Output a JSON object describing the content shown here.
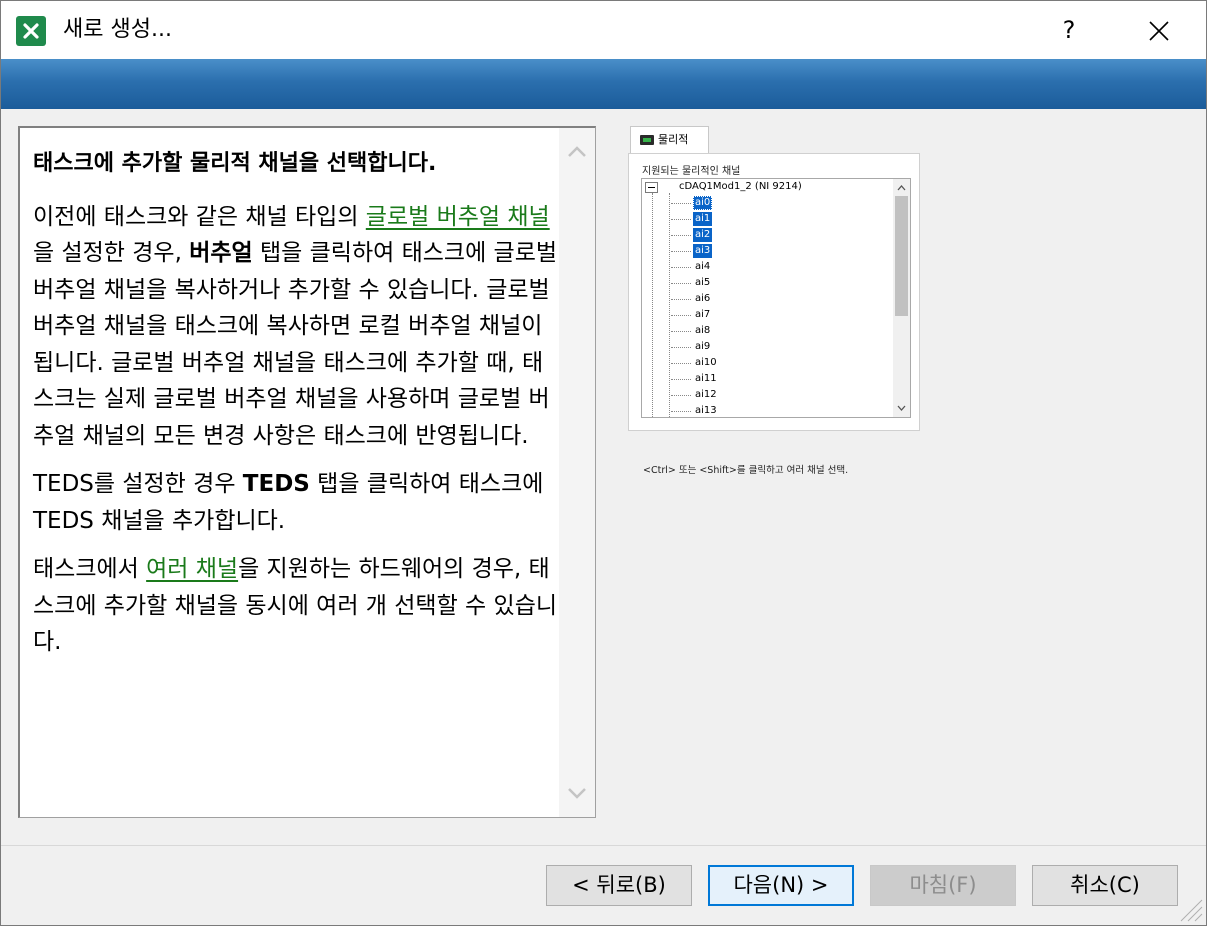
{
  "window": {
    "title": "새로 생성...",
    "help_label": "?"
  },
  "help": {
    "heading": "태스크에 추가할 물리적 채널을 선택합니다.",
    "p1": {
      "t1": "이전에 태스크와 같은 채널 타입의 ",
      "link1": "글로벌 버추얼 채널",
      "t2": "을 설정한 경우, ",
      "bold1": "버추얼",
      "t3": " 탭을 클릭하여 태스크에 글로벌 버추얼 채널을 복사하거나 추가할 수 있습니다. 글로벌 버추얼 채널을 태스크에 복사하면 로컬 버추얼 채널이 됩니다. 글로벌 버추얼 채널을 태스크에 추가할 때, 태스크는 실제 글로벌 버추얼 채널을 사용하며 글로벌 버추얼 채널의 모든 변경 사항은 태스크에 반영됩니다."
    },
    "p2": {
      "t1": "TEDS를 설정한 경우 ",
      "bold1": "TEDS",
      "t2": " 탭을 클릭하여 태스크에 TEDS 채널을 추가합니다."
    },
    "p3": {
      "t1": "태스크에서 ",
      "link1": "여러 채널",
      "t2": "을 지원하는 하드웨어의 경우, 태스크에 추가할 채널을 동시에 여러 개 선택할 수 있습니다."
    }
  },
  "physical": {
    "tab_label": "물리적",
    "supported_label": "지원되는 물리적인 채널",
    "device": "cDAQ1Mod1_2  (NI 9214)",
    "channels": [
      "ai0",
      "ai1",
      "ai2",
      "ai3",
      "ai4",
      "ai5",
      "ai6",
      "ai7",
      "ai8",
      "ai9",
      "ai10",
      "ai11",
      "ai12",
      "ai13"
    ],
    "selected": [
      "ai0",
      "ai1",
      "ai2",
      "ai3"
    ],
    "hint": "<Ctrl> 또는 <Shift>를 클릭하고 여러 채널 선택."
  },
  "buttons": {
    "back": "< 뒤로(B)",
    "next": "다음(N) >",
    "finish": "마침(F)",
    "cancel": "취소(C)"
  },
  "colors": {
    "banner": "#2b6fae",
    "link": "#1a7a1a",
    "selection": "#0a64c8",
    "app_icon": "#1f8a4c"
  }
}
